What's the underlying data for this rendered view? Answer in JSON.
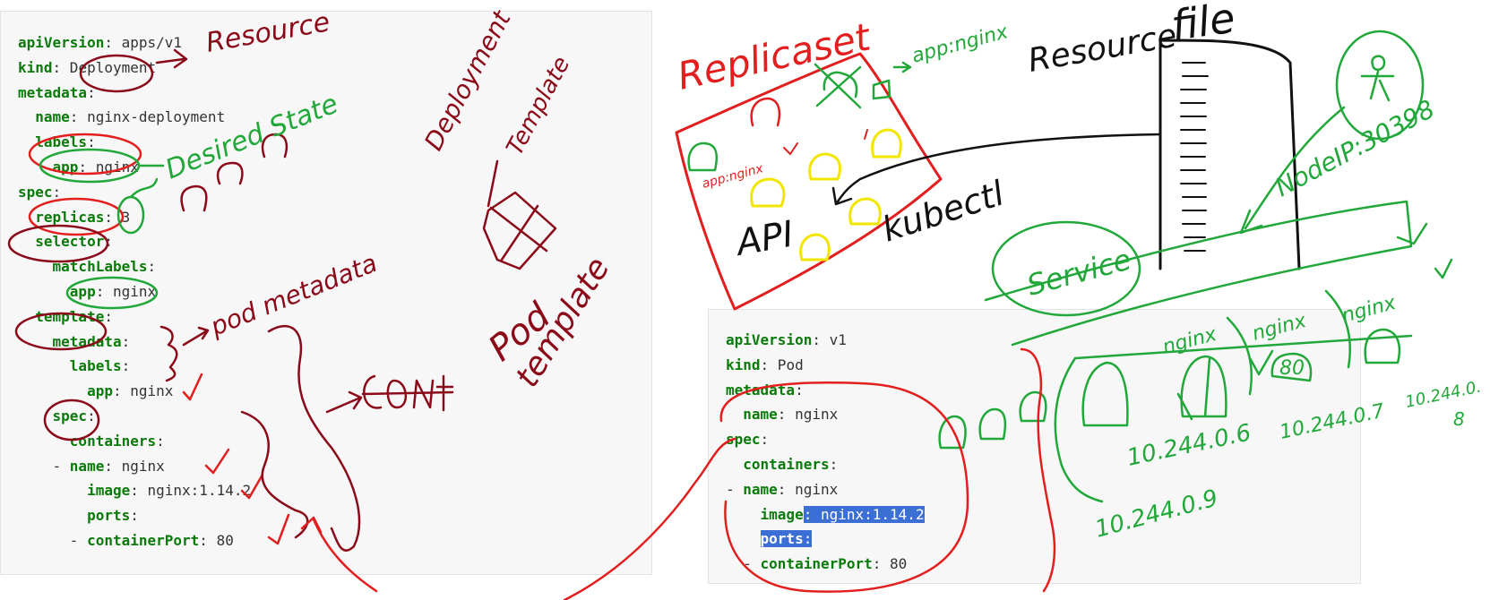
{
  "colors": {
    "red": "#e21e1e",
    "maroon": "#8b0a1a",
    "green": "#22a83a",
    "yellow": "#f2e600",
    "black": "#111111",
    "key": "#0a7a0a",
    "selection": "#3b6fd6"
  },
  "yaml_left": {
    "lines": [
      {
        "indent": 0,
        "key": "apiVersion",
        "value": " apps/v1"
      },
      {
        "indent": 0,
        "key": "kind",
        "value": " Deployment"
      },
      {
        "indent": 0,
        "key": "metadata",
        "value": ""
      },
      {
        "indent": 1,
        "key": "name",
        "value": " nginx-deployment"
      },
      {
        "indent": 1,
        "key": "labels",
        "value": ""
      },
      {
        "indent": 2,
        "key": "app",
        "value": " nginx"
      },
      {
        "indent": 0,
        "key": "spec",
        "value": ""
      },
      {
        "indent": 1,
        "key": "replicas",
        "value": " 3"
      },
      {
        "indent": 1,
        "key": "selector",
        "value": ""
      },
      {
        "indent": 2,
        "key": "matchLabels",
        "value": ""
      },
      {
        "indent": 3,
        "key": "app",
        "value": " nginx"
      },
      {
        "indent": 1,
        "key": "template",
        "value": ""
      },
      {
        "indent": 2,
        "key": "metadata",
        "value": ""
      },
      {
        "indent": 3,
        "key": "labels",
        "value": ""
      },
      {
        "indent": 4,
        "key": "app",
        "value": " nginx"
      },
      {
        "indent": 2,
        "key": "spec",
        "value": ""
      },
      {
        "indent": 3,
        "key": "containers",
        "value": ""
      },
      {
        "indent": 3,
        "key": "name",
        "value": " nginx",
        "dash": true
      },
      {
        "indent": 4,
        "key": "image",
        "value": " nginx:1.14.2"
      },
      {
        "indent": 4,
        "key": "ports",
        "value": ""
      },
      {
        "indent": 4,
        "key": "containerPort",
        "value": " 80",
        "dash": true
      }
    ]
  },
  "yaml_right": {
    "lines": [
      {
        "indent": 0,
        "key": "apiVersion",
        "value": " v1"
      },
      {
        "indent": 0,
        "key": "kind",
        "value": " Pod"
      },
      {
        "indent": 0,
        "key": "metadata",
        "value": ""
      },
      {
        "indent": 1,
        "key": "name",
        "value": " nginx"
      },
      {
        "indent": 0,
        "key": "spec",
        "value": ""
      },
      {
        "indent": 1,
        "key": "containers",
        "value": ""
      },
      {
        "indent": 1,
        "key": "name",
        "value": " nginx",
        "dash": true
      },
      {
        "indent": 2,
        "key": "image",
        "value": " nginx:1.14.2",
        "selected_value": true
      },
      {
        "indent": 2,
        "key": "ports",
        "value": "",
        "selected_all": true
      },
      {
        "indent": 2,
        "key": "containerPort",
        "value": " 80",
        "dash": true
      }
    ]
  },
  "annotations": {
    "resource_left": "Resource",
    "desired_state": "Desired State",
    "deployment": "Deployment",
    "template_top": "Template",
    "pod_metadata": "pod metadata",
    "pod": "Pod",
    "template_pod": "template",
    "replicaset": "Replicaset",
    "app_nginx_top": "app:nginx",
    "app_nginx_small": "app:nginx",
    "api": "API",
    "kubectl": "kubectl",
    "resource_right": "Resource",
    "file": "file",
    "node_ip": "NodeIP:30398",
    "service": "Service",
    "nginx_1": "nginx",
    "nginx_2": "nginx",
    "nginx_3": "nginx",
    "port_80": "80",
    "ip_1": "10.244.0.6",
    "ip_2": "10.244.0.7",
    "ip_3": "10.244.0.",
    "ip_3b": "8",
    "ip_4": "10.244.0.9"
  }
}
